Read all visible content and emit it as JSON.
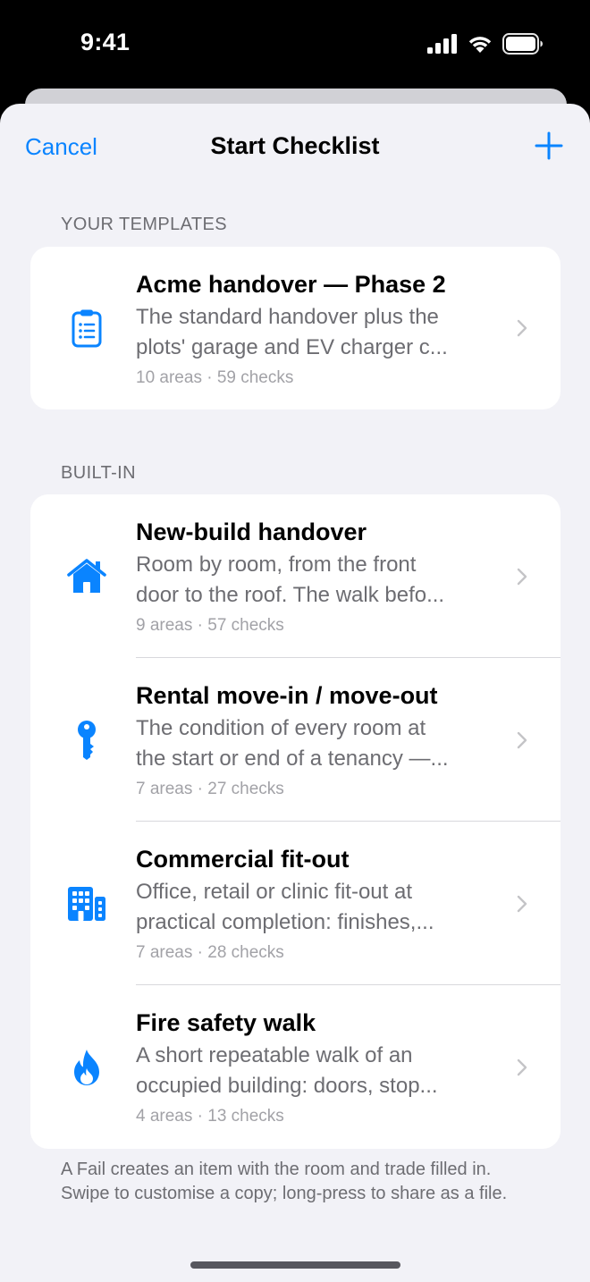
{
  "status_bar": {
    "time": "9:41"
  },
  "nav": {
    "cancel_label": "Cancel",
    "title": "Start Checklist",
    "add_icon": "plus-icon"
  },
  "sections": [
    {
      "header": "YOUR TEMPLATES",
      "rows": [
        {
          "icon": "clipboard-list-icon",
          "title": "Acme handover — Phase 2",
          "desc_line1": "The standard handover plus the",
          "desc_line2": "plots' garage and EV charger c...",
          "meta": "10 areas · 59 checks"
        }
      ]
    },
    {
      "header": "BUILT-IN",
      "rows": [
        {
          "icon": "house-icon",
          "title": "New-build handover",
          "desc_line1": "Room by room, from the front",
          "desc_line2": "door to the roof. The walk befo...",
          "meta": "9 areas · 57 checks"
        },
        {
          "icon": "key-icon",
          "title": "Rental move-in / move-out",
          "desc_line1": "The condition of every room at",
          "desc_line2": "the start or end of a tenancy —...",
          "meta": "7 areas · 27 checks"
        },
        {
          "icon": "building-icon",
          "title": "Commercial fit-out",
          "desc_line1": "Office, retail or clinic fit-out at",
          "desc_line2": "practical completion: finishes,...",
          "meta": "7 areas · 28 checks"
        },
        {
          "icon": "flame-icon",
          "title": "Fire safety walk",
          "desc_line1": "A short repeatable walk of an",
          "desc_line2": "occupied building: doors, stop...",
          "meta": "4 areas · 13 checks"
        }
      ]
    }
  ],
  "footer_note": "A Fail creates an item with the room and trade filled in. Swipe to customise a copy; long-press to share as a file.",
  "colors": {
    "accent": "#0a84ff",
    "background": "#f2f2f7",
    "card": "#ffffff",
    "secondary_text": "#6d6d72"
  }
}
